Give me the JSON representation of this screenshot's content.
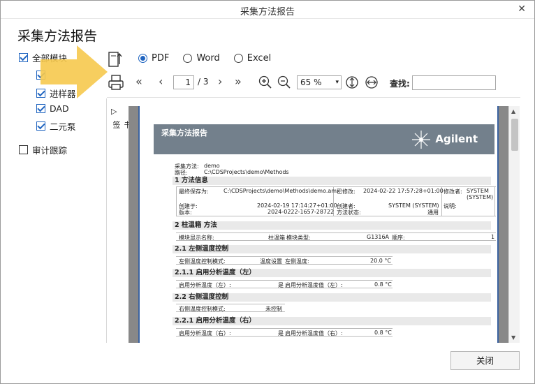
{
  "window": {
    "title": "采集方法报告",
    "close_glyph": "✕"
  },
  "heading": "采集方法报告",
  "tree": {
    "items": [
      {
        "label": "全部模块",
        "checked": true
      },
      {
        "label": "",
        "checked": true
      },
      {
        "label": "进样器",
        "checked": true
      },
      {
        "label": "DAD",
        "checked": true
      },
      {
        "label": "二元泵",
        "checked": true
      },
      {
        "label": "审计跟踪",
        "checked": false
      }
    ]
  },
  "export": {
    "options": [
      {
        "label": "PDF",
        "selected": true
      },
      {
        "label": "Word",
        "selected": false
      },
      {
        "label": "Excel",
        "selected": false
      }
    ]
  },
  "nav": {
    "first": "«",
    "prev": "‹",
    "next": "›",
    "last": "»",
    "current_page": "1",
    "total_pages": "/ 3",
    "zoom": "65 %",
    "zoom_dropdown": "▾",
    "find_label": "查找:"
  },
  "side_panel": {
    "toggle": "▷",
    "label": "书签"
  },
  "report": {
    "banner_title": "采集方法报告",
    "logo_text": "Agilent",
    "method_label": "采集方法:",
    "method_value": "demo",
    "path_label": "路径:",
    "path_value": "C:\\CDSProjects\\demo\\Methods",
    "sec1": "1 方法信息",
    "t1": {
      "r1": [
        "最终保存为:",
        "C:\\CDSProjects\\demo\\Methods\\demo.amx",
        "已修改:",
        "2024-02-22 17:57:28+01:00",
        "修改者:",
        "SYSTEM (SYSTEM)"
      ],
      "r2": [
        "创建于:",
        "2024-02-19 17:14:27+01:00",
        "创建者:",
        "SYSTEM (SYSTEM)",
        "说明:",
        ""
      ],
      "r3": [
        "版本:",
        "2024-0222-1657-28722",
        "方法状态:",
        "通用"
      ]
    },
    "sec2": "2 柱温箱 方法",
    "t2": [
      "模块显示名称:",
      "柱温箱",
      "模块类型:",
      "G1316A",
      "顺序:",
      "1"
    ],
    "sec21": "2.1 左侧温度控制",
    "t21": [
      "左侧温度控制模式:",
      "温度设置",
      "左侧温度:",
      "20.0 °C"
    ],
    "sec211": "2.1.1 启用分析温度（左）",
    "t211": [
      "启用分析温度（左）:",
      "是",
      "启用分析温度值（左）:",
      "0.8 °C"
    ],
    "sec22": "2.2 右侧温度控制",
    "t22": [
      "右侧温度控制模式:",
      "未控制"
    ],
    "sec221": "2.2.1 启用分析温度（右）",
    "t221": [
      "启用分析温度（右）:",
      "是",
      "启用分析温度值（右）:",
      "0.8 °C"
    ]
  },
  "footer": {
    "close_label": "关闭"
  },
  "colors": {
    "accent": "#1f64c0",
    "arrow": "#f6c94e",
    "banner": "#73808c"
  }
}
